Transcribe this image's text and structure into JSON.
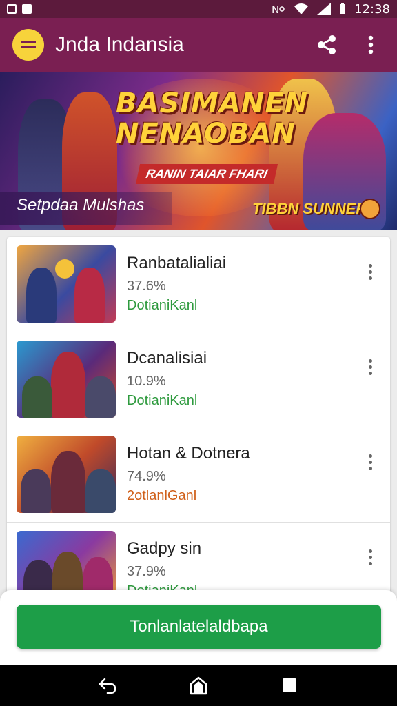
{
  "status_bar": {
    "time": "12:38",
    "icons": [
      "notification-icon",
      "notification-icon",
      "nfc-icon",
      "wifi-icon",
      "signal-icon",
      "battery-icon"
    ]
  },
  "app_bar": {
    "title": "Jnda Indansia",
    "menu_icon": "menu-icon",
    "actions": [
      "share-icon",
      "more-vert-icon"
    ]
  },
  "banner": {
    "title_line1": "BASIMANEN",
    "title_line2": "NENAOBAN",
    "ribbon": "RANIN TAIAR FHARI",
    "subtitle": "Setpdaa Mulshas",
    "badge": "TIBBN SUNNER"
  },
  "games": [
    {
      "title": "Ranbatalialiai",
      "percent": "37.6%",
      "status": "DotianiKanl",
      "status_color": "#2e9a3e"
    },
    {
      "title": "Dcanalisiai",
      "percent": "10.9%",
      "status": "DotianiKanl",
      "status_color": "#2e9a3e"
    },
    {
      "title": "Hotan & Dotnera",
      "percent": "74.9%",
      "status": "2otlanlGanl",
      "status_color": "#d0601a"
    },
    {
      "title": "Gadpy sin",
      "percent": "37.9%",
      "status": "DotianiKanl",
      "status_color": "#2e9a3e"
    }
  ],
  "primary_action": {
    "label": "Tonlanlatelaldbapa"
  },
  "nav_bar": {
    "icons": [
      "back-icon",
      "home-icon",
      "recents-icon"
    ]
  },
  "colors": {
    "status_bar": "#5c1a3c",
    "app_bar": "#7a1f52",
    "menu_button": "#f7d33b",
    "primary_button": "#1d9e48"
  }
}
